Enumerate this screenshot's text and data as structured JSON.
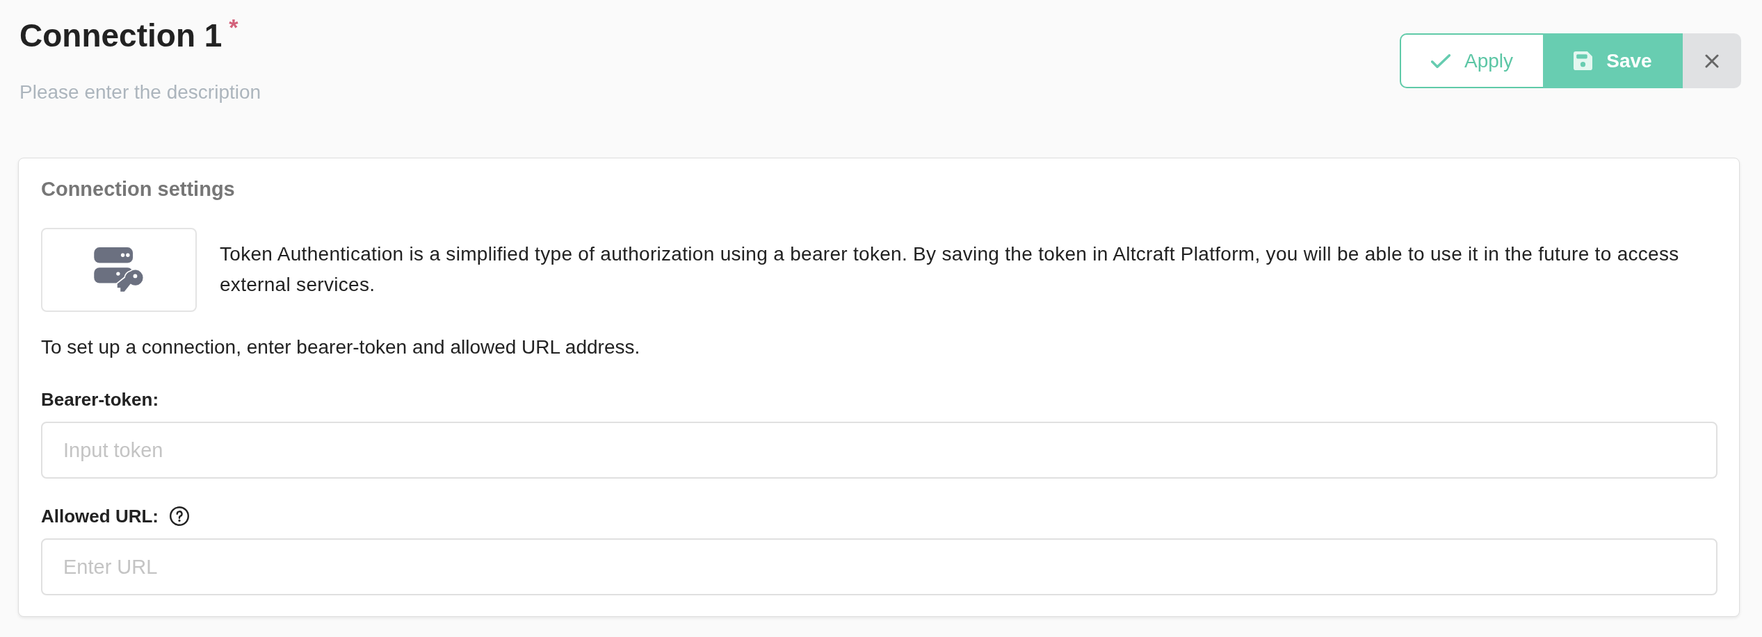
{
  "header": {
    "title": "Connection 1",
    "required_mark": "*",
    "description": {
      "placeholder": "Please enter the description"
    }
  },
  "actions": [
    {
      "kind": "apply",
      "label": "Apply"
    },
    {
      "kind": "save",
      "label": "Save"
    },
    {
      "kind": "close"
    }
  ],
  "card": {
    "title": "Connection settings",
    "intro": "Token Authentication is a simplified type of authorization using a bearer token. By saving the token in Altcraft Platform, you will be able to use it in the future to access external services.",
    "instruction": "To set up a connection, enter bearer-token and allowed URL address.",
    "fields": [
      {
        "label": "Bearer-token:",
        "placeholder": "Input token",
        "help": false
      },
      {
        "label": "Allowed URL:",
        "placeholder": "Enter URL",
        "help": true
      }
    ]
  }
}
